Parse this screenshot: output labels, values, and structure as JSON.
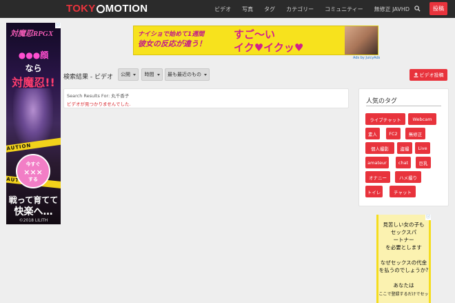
{
  "brand": {
    "part1": "TOKY",
    "part2": "MOTION"
  },
  "nav": {
    "items": [
      "ビデオ",
      "写真",
      "タグ",
      "カテゴリー",
      "コミュニティー",
      "無修正 JAVHD"
    ],
    "post_label": "投稿",
    "search_icon": "search-icon"
  },
  "left_ad": {
    "corner": "ⓘ",
    "logo": "対魔忍RPGX",
    "line1": "●●●顔",
    "line2": "なら",
    "line3": "対魔忍!!",
    "caution": "CAUTION",
    "circle_top": "今すぐ",
    "circle_mid": "×××",
    "circle_bottom": "する",
    "bottom1": "戦って育てて",
    "bottom2": "快楽へ…",
    "copyright": "©2018 LILITH"
  },
  "banner": {
    "line1": "ナイショで始めて1週間",
    "line2": "彼女の反応が違う！",
    "right1": "すご〜い",
    "right2": "イク♥イクッ♥",
    "ads_by": "Ads by JuicyAds"
  },
  "toolbar": {
    "title": "検索結果 - ビデオ",
    "dropdowns": [
      "公開",
      "時間",
      "最も最近のもの"
    ],
    "upload_label": "ビデオ投稿"
  },
  "results": {
    "query": "Search Results For: 丸千香子",
    "error": "ビデオが見つかりませんでした."
  },
  "sidebar": {
    "title": "人気のタグ",
    "tags": [
      "ライブチャット",
      "Webcam",
      "素人",
      "FC2",
      "無修正",
      "個人撮影",
      "盗撮",
      "Live",
      "amateur",
      "chat",
      "巨乳",
      "オナニー",
      "ハメ撮り",
      "トイレ",
      "チャット"
    ]
  },
  "right_ad": {
    "corner": "ⓘ",
    "lines": [
      "見苦しい女の子も",
      "セックスパ",
      "ートナー",
      "を必要とします",
      "なぜセックスの代金",
      "を払うのでしょうか?",
      "あなたは",
      "ここで登録するだけでセッ"
    ]
  },
  "colors": {
    "navbar": "#2b2b2b",
    "accent": "#e8333c",
    "background": "#eeeeee",
    "error_text": "#d8232a"
  }
}
